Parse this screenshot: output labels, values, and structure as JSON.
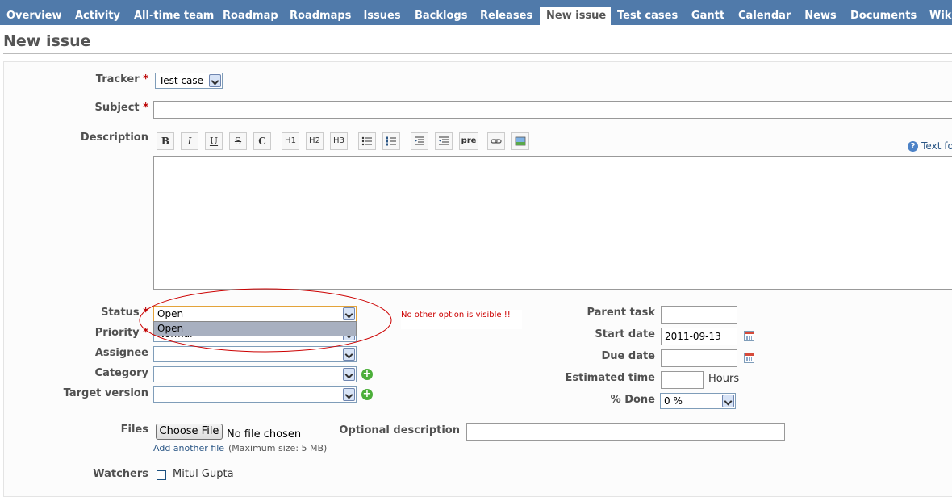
{
  "nav": {
    "tabs": [
      {
        "label": "Overview"
      },
      {
        "label": "Activity"
      },
      {
        "label": "All-time team"
      },
      {
        "label": "Roadmap"
      },
      {
        "label": "Roadmaps"
      },
      {
        "label": "Issues"
      },
      {
        "label": "Backlogs"
      },
      {
        "label": "Releases"
      },
      {
        "label": "New issue",
        "active": true
      },
      {
        "label": "Test cases"
      },
      {
        "label": "Gantt"
      },
      {
        "label": "Calendar"
      },
      {
        "label": "News"
      },
      {
        "label": "Documents"
      },
      {
        "label": "Wiki"
      }
    ]
  },
  "page": {
    "title": "New issue"
  },
  "form": {
    "tracker": {
      "label": "Tracker",
      "required": "*",
      "value": "Test case"
    },
    "subject": {
      "label": "Subject",
      "required": "*",
      "value": ""
    },
    "description": {
      "label": "Description",
      "toolbar": [
        "B",
        "I",
        "U",
        "S",
        "C",
        "H1",
        "H2",
        "H3",
        "ul",
        "ol",
        "indent-left",
        "indent-right",
        "pre",
        "link",
        "image"
      ],
      "text_formatting_link": "Text formatting"
    },
    "status": {
      "label": "Status",
      "required": "*",
      "value": "Open",
      "dropdown_options": [
        "Open"
      ]
    },
    "priority": {
      "label": "Priority",
      "required": "*",
      "value": "Normal"
    },
    "assignee": {
      "label": "Assignee",
      "value": ""
    },
    "category": {
      "label": "Category",
      "value": ""
    },
    "target_version": {
      "label": "Target version",
      "value": ""
    },
    "parent_task": {
      "label": "Parent task",
      "value": ""
    },
    "start_date": {
      "label": "Start date",
      "value": "2011-09-13"
    },
    "due_date": {
      "label": "Due date",
      "value": ""
    },
    "estimated_time": {
      "label": "Estimated time",
      "value": "",
      "unit": "Hours"
    },
    "done": {
      "label": "% Done",
      "value": "0 %"
    },
    "files": {
      "label": "Files",
      "choose_button": "Choose File",
      "no_file": "No file chosen",
      "add_another": "Add another file",
      "max_size": "(Maximum size: 5 MB)",
      "optional_description_label": "Optional description"
    },
    "watchers": {
      "label": "Watchers",
      "users": [
        "Mitul Gupta"
      ]
    }
  },
  "annotation": {
    "note": "No other option is visible !!",
    "color": "#cc0000"
  }
}
